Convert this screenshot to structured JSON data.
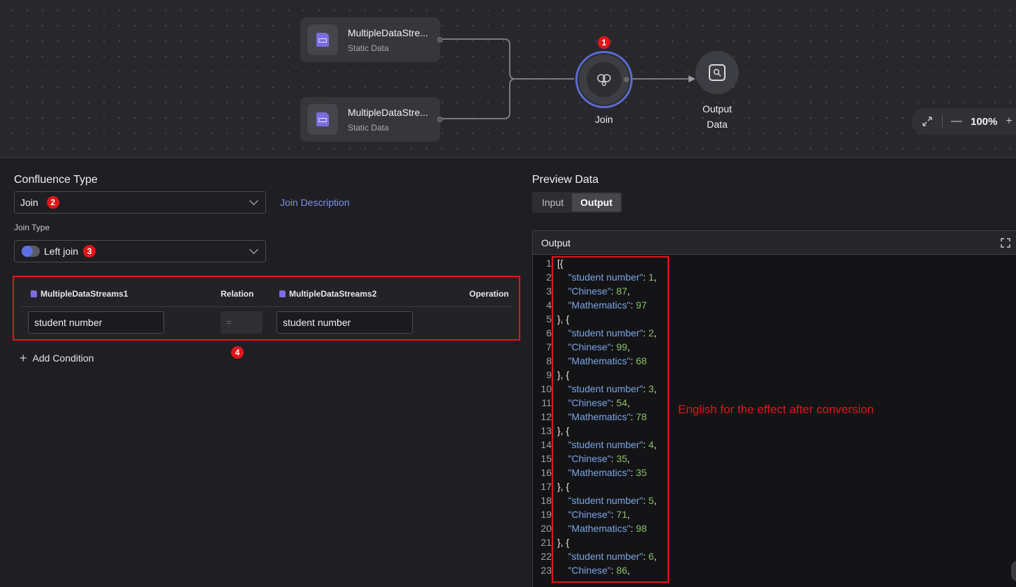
{
  "canvas": {
    "source_nodes": [
      {
        "title": "MultipleDataStre...",
        "subtitle": "Static Data"
      },
      {
        "title": "MultipleDataStre...",
        "subtitle": "Static Data"
      }
    ],
    "join_node": {
      "label": "Join"
    },
    "output_node": {
      "label_line1": "Output",
      "label_line2": "Data"
    },
    "zoom": {
      "value": "100%",
      "minus": "—",
      "plus": "+"
    }
  },
  "markers": {
    "m1": "1",
    "m2": "2",
    "m3": "3",
    "m4": "4"
  },
  "left": {
    "confluence_type_label": "Confluence Type",
    "confluence_type_value": "Join",
    "join_description_link": "Join Description",
    "join_type_label": "Join Type",
    "join_type_value": "Left join",
    "conditions": {
      "col_left": "MultipleDataStreams1",
      "col_relation": "Relation",
      "col_right": "MultipleDataStreams2",
      "col_operation": "Operation",
      "row": {
        "left": "student number",
        "relation": "=",
        "right": "student number"
      }
    },
    "add_condition": "Add Condition"
  },
  "right": {
    "preview_label": "Preview Data",
    "tabs": [
      {
        "label": "Input"
      },
      {
        "label": "Output"
      }
    ],
    "output_header": "Output",
    "code_lines": [
      {
        "n": "1",
        "t": "[{"
      },
      {
        "n": "2",
        "k": "\"student number\"",
        "v": "1",
        "c": ","
      },
      {
        "n": "3",
        "k": "\"Chinese\"",
        "v": "87",
        "c": ","
      },
      {
        "n": "4",
        "k": "\"Mathematics\"",
        "v": "97",
        "c": ""
      },
      {
        "n": "5",
        "t": "}, {"
      },
      {
        "n": "6",
        "k": "\"student number\"",
        "v": "2",
        "c": ","
      },
      {
        "n": "7",
        "k": "\"Chinese\"",
        "v": "99",
        "c": ","
      },
      {
        "n": "8",
        "k": "\"Mathematics\"",
        "v": "68",
        "c": ""
      },
      {
        "n": "9",
        "t": "}, {"
      },
      {
        "n": "10",
        "k": "\"student number\"",
        "v": "3",
        "c": ","
      },
      {
        "n": "11",
        "k": "\"Chinese\"",
        "v": "54",
        "c": ","
      },
      {
        "n": "12",
        "k": "\"Mathematics\"",
        "v": "78",
        "c": ""
      },
      {
        "n": "13",
        "t": "}, {"
      },
      {
        "n": "14",
        "k": "\"student number\"",
        "v": "4",
        "c": ","
      },
      {
        "n": "15",
        "k": "\"Chinese\"",
        "v": "35",
        "c": ","
      },
      {
        "n": "16",
        "k": "\"Mathematics\"",
        "v": "35",
        "c": ""
      },
      {
        "n": "17",
        "t": "}, {"
      },
      {
        "n": "18",
        "k": "\"student number\"",
        "v": "5",
        "c": ","
      },
      {
        "n": "19",
        "k": "\"Chinese\"",
        "v": "71",
        "c": ","
      },
      {
        "n": "20",
        "k": "\"Mathematics\"",
        "v": "98",
        "c": ""
      },
      {
        "n": "21",
        "t": "}, {"
      },
      {
        "n": "22",
        "k": "\"student number\"",
        "v": "6",
        "c": ","
      },
      {
        "n": "23",
        "k": "\"Chinese\"",
        "v": "86",
        "c": ","
      }
    ],
    "annotation": "English for the effect after conversion"
  },
  "colors": {
    "accent": "#5f70e6",
    "link": "#7b8ff0",
    "marker": "#e0151b",
    "json_key": "#7aa6e6",
    "json_number": "#8bc06b"
  }
}
